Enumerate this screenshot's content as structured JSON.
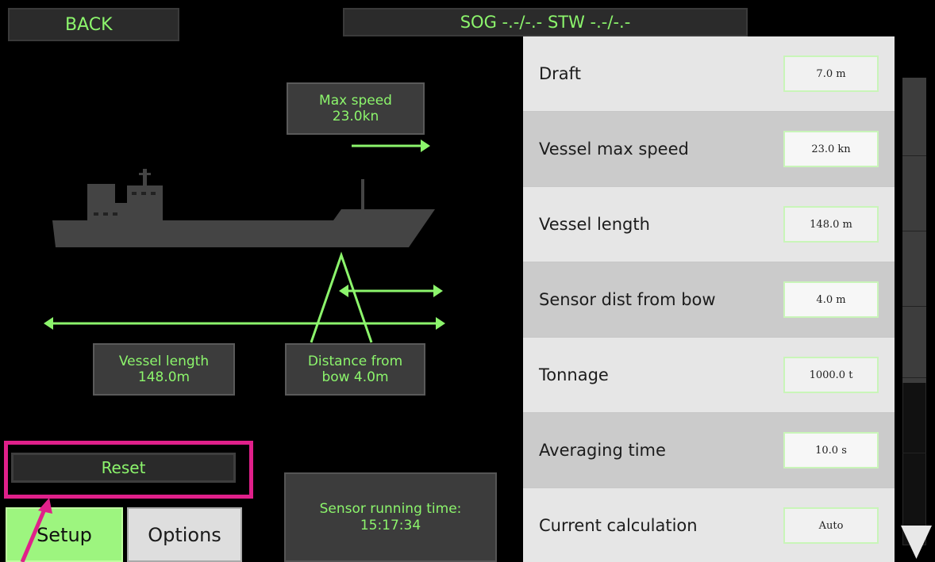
{
  "header": {
    "back_label": "BACK",
    "speed_readout": "SOG -.-/-.- STW -.-/-.-"
  },
  "diagram": {
    "max_speed_line1": "Max speed",
    "max_speed_line2": "23.0kn",
    "vessel_length_line1": "Vessel length",
    "vessel_length_line2": "148.0m",
    "distance_line1": "Distance from",
    "distance_line2": "bow 4.0m"
  },
  "controls": {
    "reset_label": "Reset",
    "sensor_line1": "Sensor running time:",
    "sensor_line2": "15:17:34"
  },
  "tabs": [
    {
      "label": "Setup",
      "active": true
    },
    {
      "label": "Options",
      "active": false
    }
  ],
  "settings": [
    {
      "label": "Draft",
      "value": "7.0 m"
    },
    {
      "label": "Vessel max speed",
      "value": "23.0 kn"
    },
    {
      "label": "Vessel length",
      "value": "148.0 m"
    },
    {
      "label": "Sensor dist from bow",
      "value": "4.0 m"
    },
    {
      "label": "Tonnage",
      "value": "1000.0 t"
    },
    {
      "label": "Averaging time",
      "value": "10.0 s"
    },
    {
      "label": "Current calculation",
      "value": "Auto"
    }
  ],
  "icons": {
    "ship": "ship-silhouette-icon",
    "scroll_down": "triangle-down-icon",
    "pointer": "arrow-pointer-icon"
  },
  "colors": {
    "accent_green": "#8cf56c",
    "highlight_magenta": "#e0208a",
    "panel_light": "#e6e6e6",
    "panel_dark": "#cbcbcb"
  }
}
